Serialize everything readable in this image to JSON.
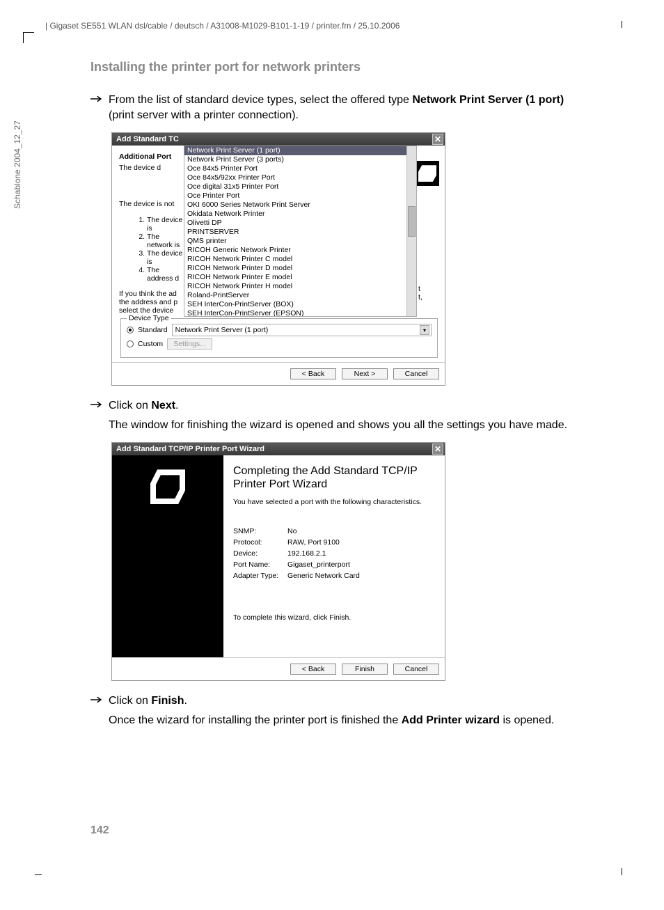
{
  "header": "| Gigaset SE551 WLAN dsl/cable / deutsch / A31008-M1029-B101-1-19 / printer.fm / 25.10.2006",
  "sidebar": "Schablone 2004_12_27",
  "section_title": "Installing the printer port for network printers",
  "step1": {
    "pre": "From the list of standard device types, select the offered type ",
    "bold": "Network Print Server (1 port)",
    "post": " (print server with a printer connection)."
  },
  "dialog1": {
    "title": "Add Standard TC",
    "additional_port": "Additional Port",
    "the_device_d": "The device d",
    "dropdown_items_highlight": "Network Print Server (1 port)",
    "dropdown_items": [
      "Network Print Server (1 port)",
      "Network Print Server (3 ports)",
      "Oce 84x5 Printer Port",
      "Oce 84x5/92xx Printer Port",
      "Oce digital 31x5 Printer Port",
      "Oce Printer Port",
      "OKI 6000 Series Network Print Server",
      "Okidata Network Printer",
      "Olivetti DP",
      "PRINTSERVER",
      "QMS printer",
      "RICOH Generic Network Printer",
      "RICOH Network Printer C model",
      "RICOH Network Printer D model",
      "RICOH Network Printer E model",
      "RICOH Network Printer H model",
      "Roland-PrintServer",
      "SEH InterCon-PrintServer (BOX)",
      "SEH InterCon-PrintServer (EPSON)"
    ],
    "not_line": "The device is not",
    "list_lines": [
      "The device is",
      "The network is",
      "The device is",
      "The address d"
    ],
    "if_think": "If you think the ad",
    "address_and": "the address and p",
    "select_device": "select the device",
    "device_type_label": "Device Type",
    "radio_standard": "Standard",
    "radio_custom": "Custom",
    "select_value": "Network Print Server (1 port)",
    "settings_btn": "Settings...",
    "back_btn": "< Back",
    "next_btn": "Next >",
    "cancel_btn": "Cancel",
    "trailing_t": "t",
    "trailing_t2": "t,"
  },
  "step2": {
    "pre": "Click on ",
    "bold": "Next",
    "post": "."
  },
  "step2_note": "The window for finishing the wizard is opened and shows you all the settings you have made.",
  "dialog2": {
    "title": "Add Standard TCP/IP Printer Port Wizard",
    "heading": "Completing the Add Standard TCP/IP Printer Port Wizard",
    "sub": "You have selected a port with the following characteristics.",
    "rows": [
      {
        "k": "SNMP:",
        "v": "No"
      },
      {
        "k": "Protocol:",
        "v": "RAW, Port 9100"
      },
      {
        "k": "Device:",
        "v": "192.168.2.1"
      },
      {
        "k": "Port Name:",
        "v": "Gigaset_printerport"
      },
      {
        "k": "Adapter Type:",
        "v": "Generic Network Card"
      }
    ],
    "finish_note": "To complete this wizard, click Finish.",
    "back_btn": "< Back",
    "finish_btn": "Finish",
    "cancel_btn": "Cancel"
  },
  "step3": {
    "pre": "Click on ",
    "bold": "Finish",
    "post": "."
  },
  "step3_note_pre": "Once the wizard for installing the printer port is finished the ",
  "step3_note_bold": "Add Printer wizard",
  "step3_note_post": " is opened.",
  "page_number": "142"
}
